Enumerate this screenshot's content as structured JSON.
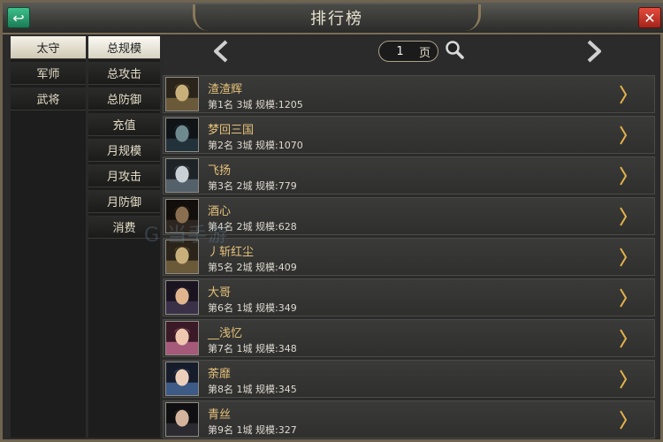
{
  "window": {
    "title": "排行榜"
  },
  "category_tabs": [
    {
      "label": "太守",
      "active": true
    },
    {
      "label": "军师",
      "active": false
    },
    {
      "label": "武将",
      "active": false
    }
  ],
  "sub_tabs": [
    {
      "label": "总规模",
      "active": true
    },
    {
      "label": "总攻击",
      "active": false
    },
    {
      "label": "总防御",
      "active": false
    },
    {
      "label": "充值",
      "active": false
    },
    {
      "label": "月规模",
      "active": false
    },
    {
      "label": "月攻击",
      "active": false
    },
    {
      "label": "月防御",
      "active": false
    },
    {
      "label": "消费",
      "active": false
    }
  ],
  "pager": {
    "page": "1",
    "unit": "页"
  },
  "rows": [
    {
      "name": "渣渣辉",
      "info": "第1名 3城 规模:1205",
      "avatar": "helmet"
    },
    {
      "name": "梦回三国",
      "info": "第2名 3城 规模:1070",
      "avatar": "warrior-dark"
    },
    {
      "name": "飞扬",
      "info": "第3名 2城 规模:779",
      "avatar": "helmet-silver"
    },
    {
      "name": "酒心",
      "info": "第4名 2城 规模:628",
      "avatar": "swordsman"
    },
    {
      "name": "丿斩红尘",
      "info": "第5名 2城 规模:409",
      "avatar": "helmet"
    },
    {
      "name": "大哥",
      "info": "第6名 1城 规模:349",
      "avatar": "scholar"
    },
    {
      "name": "__浅忆",
      "info": "第7名 1城 规模:348",
      "avatar": "lady-pink"
    },
    {
      "name": "荼靡",
      "info": "第8名 1城 规模:345",
      "avatar": "lady-blue"
    },
    {
      "name": "青丝",
      "info": "第9名 1城 规模:327",
      "avatar": "lady-dark"
    }
  ],
  "watermark": "G 当手游",
  "colors": {
    "name": "#e6c27a",
    "accent_arrow": "#e2b24a"
  }
}
